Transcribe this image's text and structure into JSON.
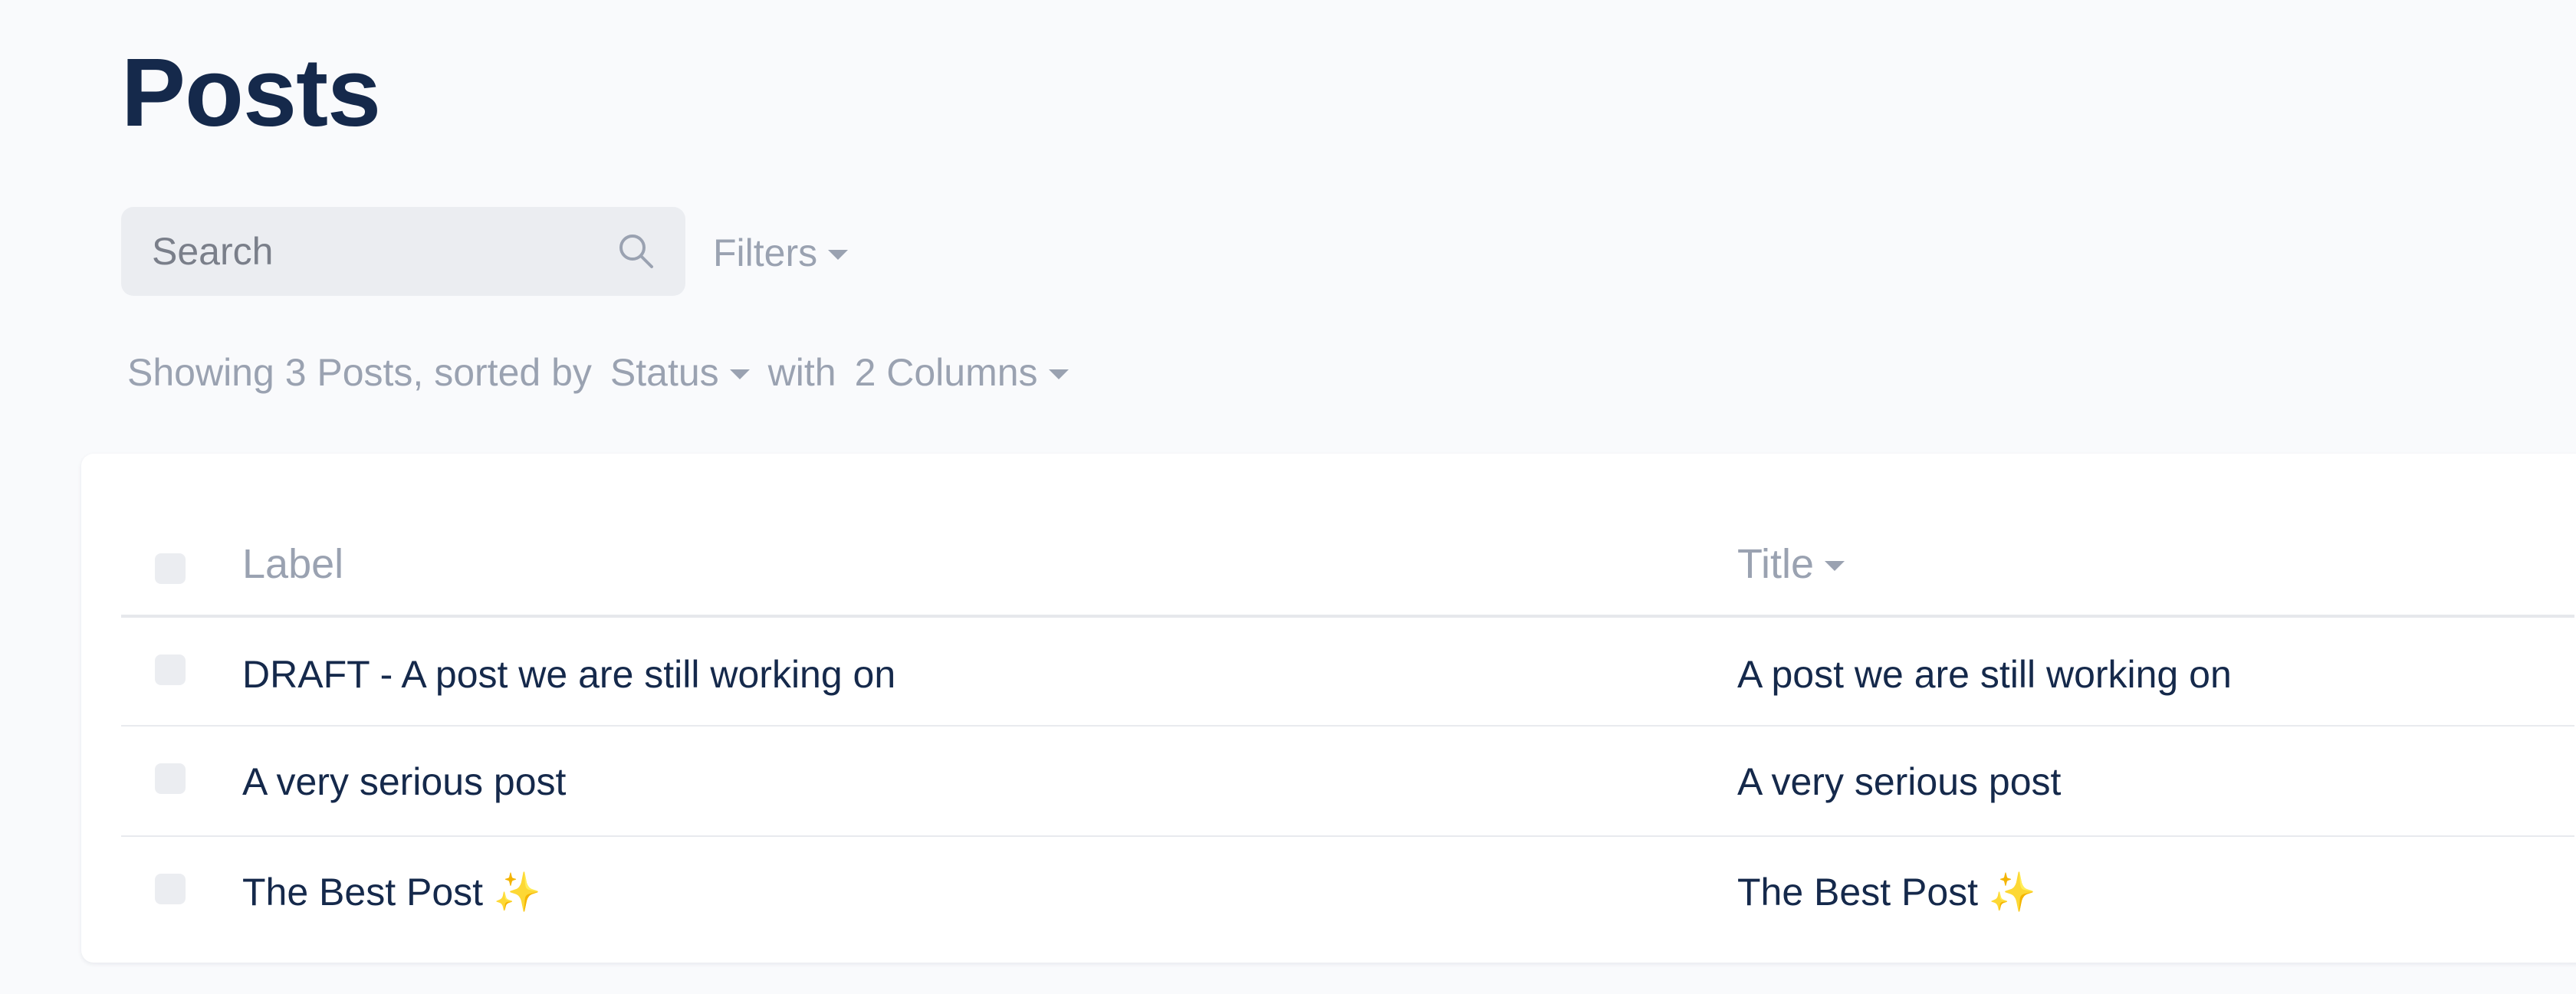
{
  "page": {
    "title": "Posts"
  },
  "search": {
    "placeholder": "Search",
    "value": "",
    "icon": "search-icon"
  },
  "filters": {
    "label": "Filters",
    "icon": "chevron-down-icon"
  },
  "summary": {
    "prefix": "Showing 3 Posts, sorted by",
    "sort_value": "Status",
    "connector": "with",
    "columns_value": "2 Columns"
  },
  "table": {
    "columns": [
      {
        "label": "Label",
        "sortable": false
      },
      {
        "label": "Title",
        "sortable": true
      }
    ],
    "rows": [
      {
        "label": "DRAFT - A post we are still working on",
        "title": "A post we are still working on",
        "selected": false
      },
      {
        "label": "A very serious post",
        "title": "A very serious post",
        "selected": false
      },
      {
        "label": "The Best Post ✨",
        "title": "The Best Post ✨",
        "selected": false
      }
    ]
  },
  "colors": {
    "heading": "#15294b",
    "muted": "#9aa2b1",
    "background": "#f9fafc",
    "input_bg": "#ebedf1",
    "card": "#ffffff"
  }
}
